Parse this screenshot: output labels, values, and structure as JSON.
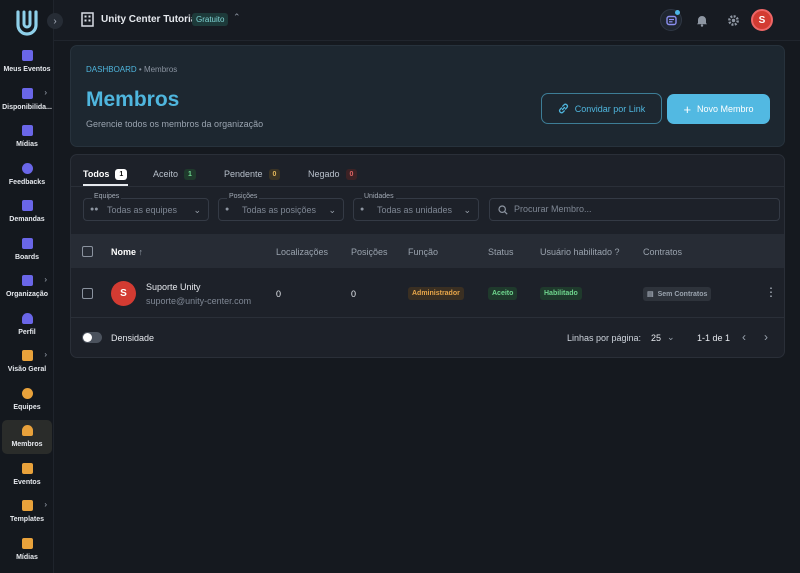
{
  "sidebar": {
    "logo": "unity-logo",
    "collapse_icon": "chevron-right-icon",
    "items": [
      {
        "label": "Meus Eventos",
        "icon": "calendar-icon"
      },
      {
        "label": "Disponibilida...",
        "icon": "calendar-clock-icon"
      },
      {
        "label": "Mídias",
        "icon": "media-icon"
      },
      {
        "label": "Feedbacks",
        "icon": "chat-bubble-icon"
      },
      {
        "label": "Demandas",
        "icon": "inbox-icon"
      },
      {
        "label": "Boards",
        "icon": "clipboard-icon"
      },
      {
        "label": "Organização",
        "icon": "building-icon"
      },
      {
        "label": "Perfil",
        "icon": "user-icon"
      },
      {
        "label": "Visão Geral",
        "icon": "chart-icon"
      },
      {
        "label": "Equipes",
        "icon": "team-icon"
      },
      {
        "label": "Membros",
        "icon": "member-icon"
      },
      {
        "label": "Eventos",
        "icon": "calendar-icon"
      },
      {
        "label": "Templates",
        "icon": "template-icon"
      },
      {
        "label": "Mídias",
        "icon": "media-icon"
      }
    ]
  },
  "topbar": {
    "org_name": "Unity Center Tutorial",
    "plan": "Gratuito",
    "avatar_initial": "S"
  },
  "header": {
    "breadcrumb_root": "DASHBOARD",
    "breadcrumb_sep": " • ",
    "breadcrumb_current": "Membros",
    "title": "Membros",
    "subtitle": "Gerencie todos os membros da organização",
    "invite_label": "Convidar por Link",
    "new_label": "Novo Membro"
  },
  "tabs": [
    {
      "label": "Todos",
      "count": "1"
    },
    {
      "label": "Aceito",
      "count": "1"
    },
    {
      "label": "Pendente",
      "count": "0"
    },
    {
      "label": "Negado",
      "count": "0"
    }
  ],
  "filters": {
    "teams": {
      "label": "Equipes",
      "value": "Todas as equipes"
    },
    "positions": {
      "label": "Posições",
      "value": "Todas as posições"
    },
    "units": {
      "label": "Unidades",
      "value": "Todas as unidades"
    },
    "search_placeholder": "Procurar Membro..."
  },
  "table": {
    "headers": {
      "name": "Nome",
      "locations": "Localizações",
      "positions": "Posições",
      "role": "Função",
      "status": "Status",
      "enabled": "Usuário habilitado ?",
      "contracts": "Contratos"
    },
    "rows": [
      {
        "initial": "S",
        "name": "Suporte Unity",
        "email": "suporte@unity-center.com",
        "locations": "0",
        "positions": "0",
        "role": "Administrador",
        "status": "Aceito",
        "enabled": "Habilitado",
        "contracts": "Sem Contratos"
      }
    ]
  },
  "footer": {
    "density": "Densidade",
    "rows_per_page_label": "Linhas por página:",
    "rows_per_page": "25",
    "range": "1-1 de 1"
  },
  "colors": {
    "accent": "#4fb6de",
    "primary_button": "#52b9e2",
    "avatar": "#d33b32",
    "sidebar_icon": "#6a66e8",
    "active_icon": "#e9a23b"
  }
}
